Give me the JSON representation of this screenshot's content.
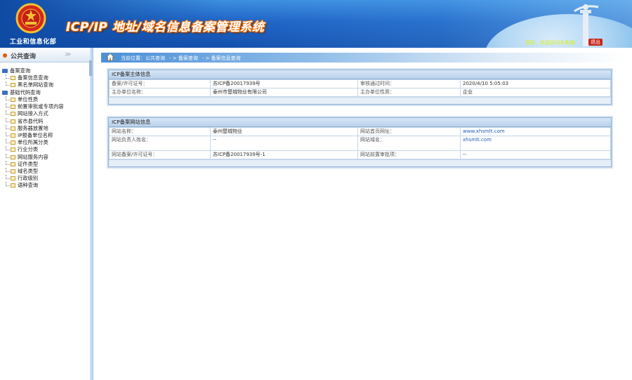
{
  "header": {
    "org_name": "工业和信息化部",
    "system_title": "ICP/IP 地址/域名信息备案管理系统",
    "welcome": "您好，欢迎访问本系统!",
    "logout_label": "退出"
  },
  "sidebar": {
    "title": "公共查询",
    "collapse_glyph": "≫",
    "groups": [
      {
        "label": "备案查询",
        "items": [
          "备案信息查询",
          "黑名单网站查询"
        ]
      },
      {
        "label": "基础代码查询",
        "items": [
          "单位性质",
          "前置审批或专项内容",
          "网站接入方式",
          "省市县代码",
          "服务器放置地",
          "IP报备单位名称",
          "单位所属分类",
          "行业分类",
          "网站服务内容",
          "证件类型",
          "域名类型",
          "行政级别",
          "语种查询"
        ]
      }
    ]
  },
  "breadcrumb": {
    "prefix": "当前位置：",
    "items": [
      "公共查询",
      "- >  备案查询",
      "- > 备案信息查询"
    ]
  },
  "subject_panel": {
    "title": "ICP备案主体信息",
    "rows": [
      {
        "k1": "备案/许可证号：",
        "v1": "苏ICP备20017939号",
        "k2": "审核通过时间：",
        "v2": "2020/4/10 5:05:03"
      },
      {
        "k1": "主办单位名称：",
        "v1": "泰州市楚城物业有限公司",
        "k2": "主办单位性质：",
        "v2": "企业"
      }
    ]
  },
  "site_panel": {
    "title": "ICP备案网站信息",
    "rows": [
      {
        "k1": "网站名称：",
        "v1": "泰州楚城物业",
        "k2": "网站首页网址：",
        "v2": "www.xhsmlt.com",
        "v2_link": true
      },
      {
        "k1": "网站负责人姓名：",
        "v1": "--",
        "k2": "网站域名：",
        "v2": "xhsmlt.com",
        "v2_link": true
      },
      {
        "k1": "网站备案/许可证号：",
        "v1": "苏ICP备20017939号-1",
        "k2": "网站前置审批项：",
        "v2": "--",
        "v2_link": false
      }
    ]
  },
  "colors": {
    "header_blue": "#1e63c4",
    "title_orange": "#f06a00",
    "link": "#1f5fb8",
    "logout_red": "#c8241a"
  }
}
